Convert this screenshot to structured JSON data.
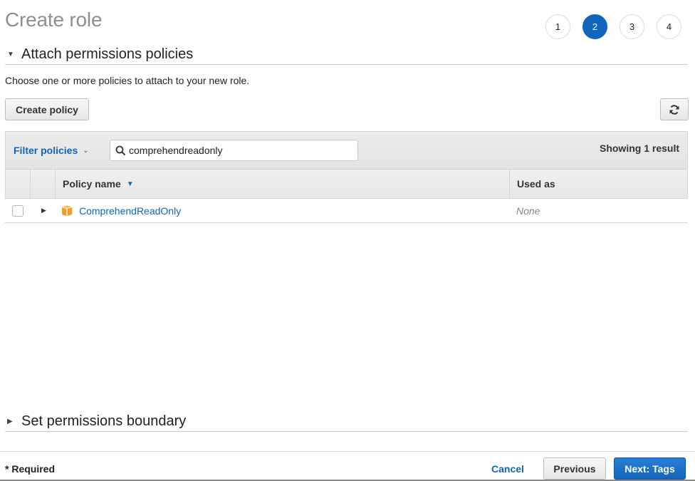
{
  "page": {
    "title": "Create role"
  },
  "steps": [
    {
      "label": "1",
      "active": false
    },
    {
      "label": "2",
      "active": true
    },
    {
      "label": "3",
      "active": false
    },
    {
      "label": "4",
      "active": false
    }
  ],
  "attach_section": {
    "title": "Attach permissions policies",
    "expanded": true,
    "description": "Choose one or more policies to attach to your new role.",
    "create_policy_label": "Create policy",
    "refresh_icon": "refresh-icon"
  },
  "filter": {
    "label": "Filter policies",
    "search_value": "comprehendreadonly",
    "search_icon": "search-icon",
    "result_count": "Showing 1 result"
  },
  "table": {
    "columns": [
      {
        "label": "Policy name",
        "sorted": "desc"
      },
      {
        "label": "Used as"
      }
    ],
    "rows": [
      {
        "checked": false,
        "icon": "aws-managed-policy-cube-icon",
        "name": "ComprehendReadOnly",
        "used_as": "None"
      }
    ]
  },
  "boundary_section": {
    "title": "Set permissions boundary",
    "expanded": false
  },
  "footer": {
    "required_label": "* Required",
    "cancel_label": "Cancel",
    "previous_label": "Previous",
    "next_label": "Next: Tags"
  },
  "colors": {
    "accent": "#1166bb",
    "policy_icon": "#f29c22"
  }
}
